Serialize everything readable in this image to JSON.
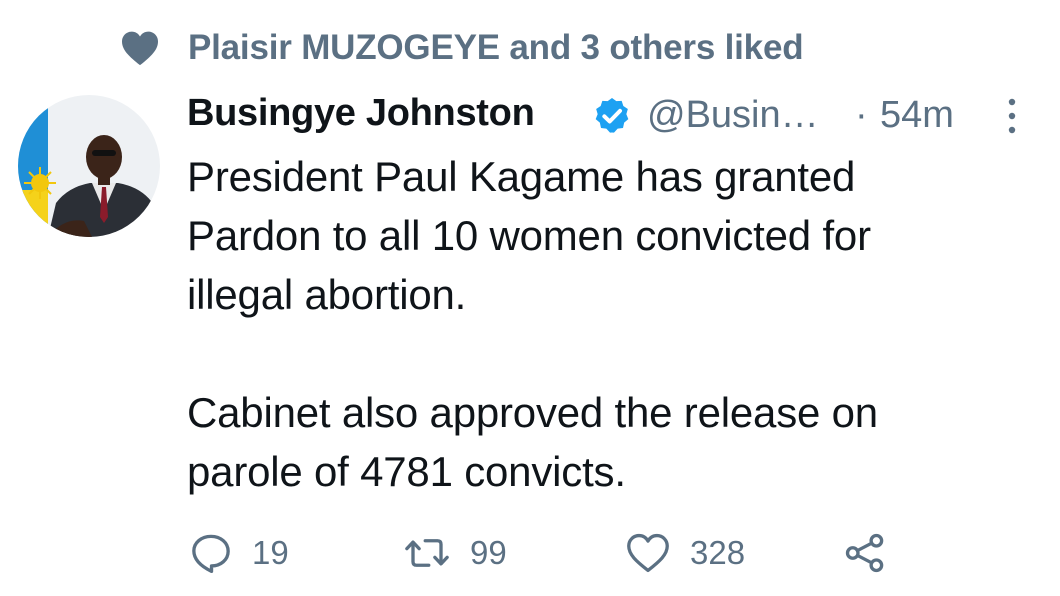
{
  "social_context": {
    "text": "Plaisir MUZOGEYE and 3 others liked",
    "icon": "heart-icon"
  },
  "author": {
    "name": "Busingye Johnston",
    "handle": "@Busin…",
    "verified": true,
    "avatar": "avatar-photo"
  },
  "meta": {
    "separator": "·",
    "timestamp": "54m"
  },
  "tweet": {
    "text": "President Paul Kagame has granted\nPardon to all 10 women convicted for\nillegal abortion.\n\nCabinet also approved the release on\nparole of 4781 convicts."
  },
  "actions": {
    "reply_count": "19",
    "retweet_count": "99",
    "like_count": "328"
  },
  "colors": {
    "text_primary": "#0f1419",
    "text_secondary": "#5b7083",
    "verified_blue": "#1da1f2",
    "background": "#ffffff"
  }
}
